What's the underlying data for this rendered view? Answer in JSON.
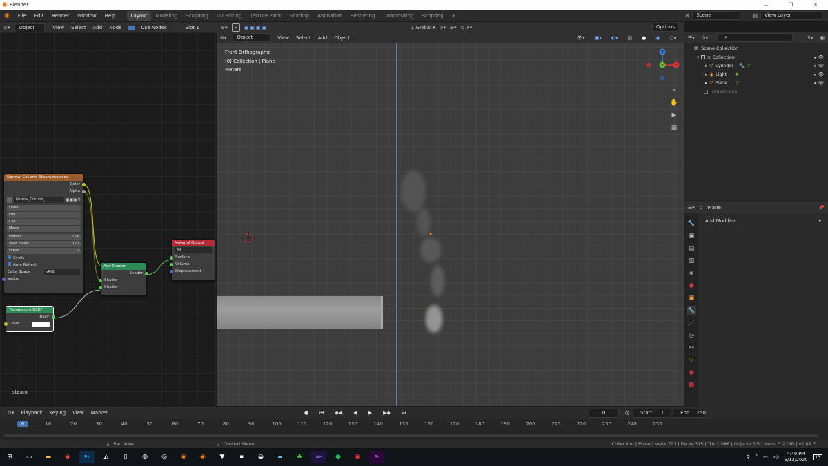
{
  "window": {
    "title": "Blender",
    "minimize": "—",
    "maximize": "❐",
    "close": "✕"
  },
  "menu": [
    "File",
    "Edit",
    "Render",
    "Window",
    "Help"
  ],
  "workspaces": [
    "Layout",
    "Modeling",
    "Sculpting",
    "UV Editing",
    "Texture Paint",
    "Shading",
    "Animation",
    "Rendering",
    "Compositing",
    "Scripting"
  ],
  "active_workspace": "Layout",
  "add_workspace": "+",
  "scene": {
    "label": "Scene",
    "view_layer": "View Layer"
  },
  "node_header": {
    "object": "Object",
    "view": "View",
    "select": "Select",
    "add": "Add",
    "node": "Node",
    "use_nodes": "Use Nodes",
    "slot": "Slot 1"
  },
  "nodes": {
    "image_texture": {
      "title": "Narrow_Column_Steam.mov.dds",
      "outputs": [
        "Color",
        "Alpha"
      ],
      "image": "Narrow_Column_...",
      "interpolation": "Linear",
      "projection": "Flat",
      "extension": "Clip",
      "source": "Movie",
      "frames_label": "Frames",
      "frames": "164",
      "start_label": "Start Frame",
      "start": "110",
      "offset_label": "Offset",
      "offset": "0",
      "cyclic": "Cyclic",
      "auto_refresh": "Auto Refresh",
      "color_space_label": "Color Space",
      "color_space": "sRGB",
      "vector": "Vector"
    },
    "add_shader": {
      "title": "Add Shader",
      "output": "Shader",
      "inputs": [
        "Shader",
        "Shader"
      ]
    },
    "material_output": {
      "title": "Material Output",
      "target": "All",
      "inputs": [
        "Surface",
        "Volume",
        "Displacement"
      ]
    },
    "transparent": {
      "title": "Transparent BSDF",
      "output": "BSDF",
      "color_label": "Color"
    }
  },
  "material_name": "steam",
  "viewport": {
    "mode": "Object Mode",
    "menus": [
      "View",
      "Select",
      "Add",
      "Object"
    ],
    "transform": "Global",
    "options": "Options",
    "view_name": "Front Orthographic",
    "collection": "(0) Collection | Plane",
    "units": "Meters",
    "gizmo": {
      "z": "Z",
      "y": "Y",
      "x": "X"
    }
  },
  "outliner": {
    "search_placeholder": "",
    "items": [
      {
        "label": "Scene Collection",
        "icon": "scene-collection-icon"
      },
      {
        "label": "Collection",
        "icon": "collection-icon"
      },
      {
        "label": "Cylinder",
        "icon": "mesh-icon"
      },
      {
        "label": "Light",
        "icon": "light-icon"
      },
      {
        "label": "Plane",
        "icon": "mesh-icon"
      },
      {
        "label": "otherscene",
        "icon": "collection-icon"
      }
    ]
  },
  "properties": {
    "object": "Plane",
    "add_modifier": "Add Modifier"
  },
  "timeline": {
    "menus": [
      "Playback",
      "Keying",
      "View",
      "Marker"
    ],
    "current_frame": "0",
    "start_label": "Start",
    "start": "1",
    "end_label": "End",
    "end": "250",
    "ticks": [
      "0",
      "10",
      "20",
      "30",
      "40",
      "50",
      "60",
      "70",
      "80",
      "90",
      "100",
      "110",
      "120",
      "130",
      "140",
      "150",
      "160",
      "170",
      "180",
      "190",
      "200",
      "210",
      "220",
      "230",
      "240",
      "250"
    ]
  },
  "status": {
    "pan": "Pan View",
    "context": "Context Menu",
    "stats": "Collection | Plane | Verts:791 | Faces:515 | Tris:1,086 | Objects:0/3 | Mem: 3.2 GiB | v2.82.7"
  },
  "taskbar": {
    "time": "4:40 PM",
    "date": "5/13/2020",
    "notif": "13"
  }
}
